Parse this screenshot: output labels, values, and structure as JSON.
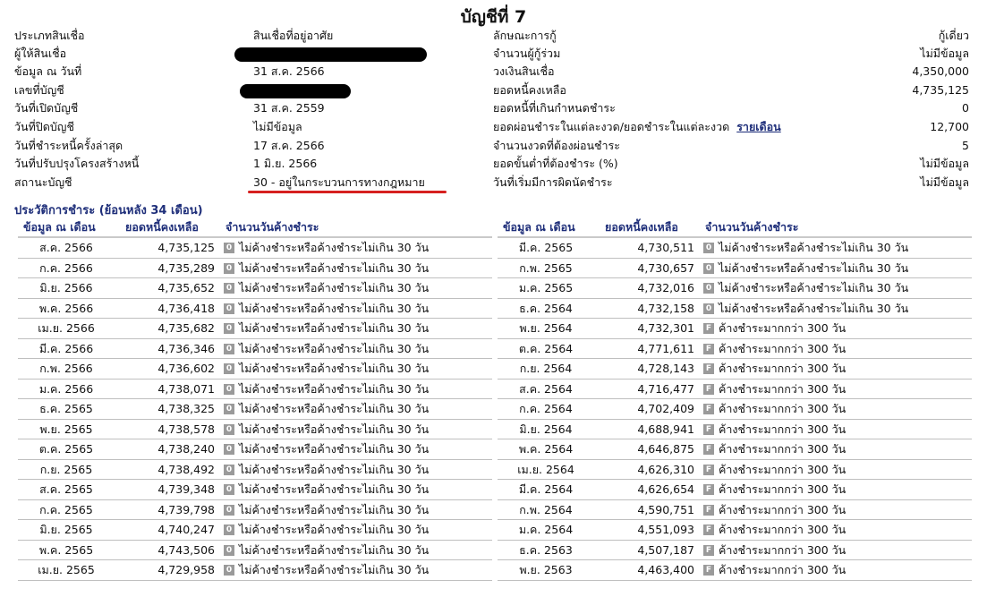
{
  "title": "บัญชีที่ 7",
  "info_left": [
    {
      "label": "ประเภทสินเชื่อ",
      "value": "สินเชื่อที่อยู่อาศัย"
    },
    {
      "label": "ผู้ให้สินเชื่อ",
      "value": ""
    },
    {
      "label": "ข้อมูล ณ วันที่",
      "value": "31 ส.ค. 2566"
    },
    {
      "label": "เลขที่บัญชี",
      "value": ""
    },
    {
      "label": "วันที่เปิดบัญชี",
      "value": "31 ส.ค. 2559"
    },
    {
      "label": "วันที่ปิดบัญชี",
      "value": "ไม่มีข้อมูล"
    },
    {
      "label": "วันที่ชำระหนี้ครั้งล่าสุด",
      "value": "17 ส.ค. 2566"
    },
    {
      "label": "วันที่ปรับปรุงโครงสร้างหนี้",
      "value": "1 มิ.ย. 2566"
    },
    {
      "label": "สถานะบัญชี",
      "value": "30 - อยู่ในกระบวนการทางกฎหมาย"
    }
  ],
  "info_right": [
    {
      "label": "ลักษณะการกู้",
      "value": "กู้เดี่ยว"
    },
    {
      "label": "จำนวนผู้กู้ร่วม",
      "value": "ไม่มีข้อมูล"
    },
    {
      "label": "วงเงินสินเชื่อ",
      "value": "4,350,000"
    },
    {
      "label": "ยอดหนี้คงเหลือ",
      "value": "4,735,125"
    },
    {
      "label": "ยอดหนี้ที่เกินกำหนดชำระ",
      "value": "0"
    },
    {
      "label": "ยอดผ่อนชำระในแต่ละงวด/ยอดชำระในแต่ละงวด",
      "label_link": "รายเดือน",
      "value": "12,700"
    },
    {
      "label": "จำนวนงวดที่ต้องผ่อนชำระ",
      "value": "5"
    },
    {
      "label": "ยอดขั้นต่ำที่ต้องชำระ (%)",
      "value": "ไม่มีข้อมูล"
    },
    {
      "label": "วันที่เริ่มมีการผิดนัดชำระ",
      "value": "ไม่มีข้อมูล"
    }
  ],
  "history_title": "ประวัติการชำระ (ย้อนหลัง 34 เดือน)",
  "history_headers": [
    "ข้อมูล ณ เดือน",
    "ยอดหนี้คงเหลือ",
    "จำนวนวันค้างชำระ"
  ],
  "history_left": [
    {
      "month": "ส.ค. 2566",
      "balance": "4,735,125",
      "code": "0",
      "desc": "ไม่ค้างชำระหรือค้างชำระไม่เกิน 30 วัน"
    },
    {
      "month": "ก.ค. 2566",
      "balance": "4,735,289",
      "code": "0",
      "desc": "ไม่ค้างชำระหรือค้างชำระไม่เกิน 30 วัน"
    },
    {
      "month": "มิ.ย. 2566",
      "balance": "4,735,652",
      "code": "0",
      "desc": "ไม่ค้างชำระหรือค้างชำระไม่เกิน 30 วัน"
    },
    {
      "month": "พ.ค. 2566",
      "balance": "4,736,418",
      "code": "0",
      "desc": "ไม่ค้างชำระหรือค้างชำระไม่เกิน 30 วัน"
    },
    {
      "month": "เม.ย. 2566",
      "balance": "4,735,682",
      "code": "0",
      "desc": "ไม่ค้างชำระหรือค้างชำระไม่เกิน 30 วัน"
    },
    {
      "month": "มี.ค. 2566",
      "balance": "4,736,346",
      "code": "0",
      "desc": "ไม่ค้างชำระหรือค้างชำระไม่เกิน 30 วัน"
    },
    {
      "month": "ก.พ. 2566",
      "balance": "4,736,602",
      "code": "0",
      "desc": "ไม่ค้างชำระหรือค้างชำระไม่เกิน 30 วัน"
    },
    {
      "month": "ม.ค. 2566",
      "balance": "4,738,071",
      "code": "0",
      "desc": "ไม่ค้างชำระหรือค้างชำระไม่เกิน 30 วัน"
    },
    {
      "month": "ธ.ค. 2565",
      "balance": "4,738,325",
      "code": "0",
      "desc": "ไม่ค้างชำระหรือค้างชำระไม่เกิน 30 วัน"
    },
    {
      "month": "พ.ย. 2565",
      "balance": "4,738,578",
      "code": "0",
      "desc": "ไม่ค้างชำระหรือค้างชำระไม่เกิน 30 วัน"
    },
    {
      "month": "ต.ค. 2565",
      "balance": "4,738,240",
      "code": "0",
      "desc": "ไม่ค้างชำระหรือค้างชำระไม่เกิน 30 วัน"
    },
    {
      "month": "ก.ย. 2565",
      "balance": "4,738,492",
      "code": "0",
      "desc": "ไม่ค้างชำระหรือค้างชำระไม่เกิน 30 วัน"
    },
    {
      "month": "ส.ค. 2565",
      "balance": "4,739,348",
      "code": "0",
      "desc": "ไม่ค้างชำระหรือค้างชำระไม่เกิน 30 วัน"
    },
    {
      "month": "ก.ค. 2565",
      "balance": "4,739,798",
      "code": "0",
      "desc": "ไม่ค้างชำระหรือค้างชำระไม่เกิน 30 วัน"
    },
    {
      "month": "มิ.ย. 2565",
      "balance": "4,740,247",
      "code": "0",
      "desc": "ไม่ค้างชำระหรือค้างชำระไม่เกิน 30 วัน"
    },
    {
      "month": "พ.ค. 2565",
      "balance": "4,743,506",
      "code": "0",
      "desc": "ไม่ค้างชำระหรือค้างชำระไม่เกิน 30 วัน"
    },
    {
      "month": "เม.ย. 2565",
      "balance": "4,729,958",
      "code": "0",
      "desc": "ไม่ค้างชำระหรือค้างชำระไม่เกิน 30 วัน"
    }
  ],
  "history_right": [
    {
      "month": "มี.ค. 2565",
      "balance": "4,730,511",
      "code": "0",
      "desc": "ไม่ค้างชำระหรือค้างชำระไม่เกิน 30 วัน"
    },
    {
      "month": "ก.พ. 2565",
      "balance": "4,730,657",
      "code": "0",
      "desc": "ไม่ค้างชำระหรือค้างชำระไม่เกิน 30 วัน"
    },
    {
      "month": "ม.ค. 2565",
      "balance": "4,732,016",
      "code": "0",
      "desc": "ไม่ค้างชำระหรือค้างชำระไม่เกิน 30 วัน"
    },
    {
      "month": "ธ.ค. 2564",
      "balance": "4,732,158",
      "code": "0",
      "desc": "ไม่ค้างชำระหรือค้างชำระไม่เกิน 30 วัน"
    },
    {
      "month": "พ.ย. 2564",
      "balance": "4,732,301",
      "code": "F",
      "desc": "ค้างชำระมากกว่า 300 วัน"
    },
    {
      "month": "ต.ค. 2564",
      "balance": "4,771,611",
      "code": "F",
      "desc": "ค้างชำระมากกว่า 300 วัน"
    },
    {
      "month": "ก.ย. 2564",
      "balance": "4,728,143",
      "code": "F",
      "desc": "ค้างชำระมากกว่า 300 วัน"
    },
    {
      "month": "ส.ค. 2564",
      "balance": "4,716,477",
      "code": "F",
      "desc": "ค้างชำระมากกว่า 300 วัน"
    },
    {
      "month": "ก.ค. 2564",
      "balance": "4,702,409",
      "code": "F",
      "desc": "ค้างชำระมากกว่า 300 วัน"
    },
    {
      "month": "มิ.ย. 2564",
      "balance": "4,688,941",
      "code": "F",
      "desc": "ค้างชำระมากกว่า 300 วัน"
    },
    {
      "month": "พ.ค. 2564",
      "balance": "4,646,875",
      "code": "F",
      "desc": "ค้างชำระมากกว่า 300 วัน"
    },
    {
      "month": "เม.ย. 2564",
      "balance": "4,626,310",
      "code": "F",
      "desc": "ค้างชำระมากกว่า 300 วัน"
    },
    {
      "month": "มี.ค. 2564",
      "balance": "4,626,654",
      "code": "F",
      "desc": "ค้างชำระมากกว่า 300 วัน"
    },
    {
      "month": "ก.พ. 2564",
      "balance": "4,590,751",
      "code": "F",
      "desc": "ค้างชำระมากกว่า 300 วัน"
    },
    {
      "month": "ม.ค. 2564",
      "balance": "4,551,093",
      "code": "F",
      "desc": "ค้างชำระมากกว่า 300 วัน"
    },
    {
      "month": "ธ.ค. 2563",
      "balance": "4,507,187",
      "code": "F",
      "desc": "ค้างชำระมากกว่า 300 วัน"
    },
    {
      "month": "พ.ย. 2563",
      "balance": "4,463,400",
      "code": "F",
      "desc": "ค้างชำระมากกว่า 300 วัน"
    }
  ],
  "colors": {
    "section_title": "#1f2f7a",
    "status_underline": "#d6201f",
    "badge_bg": "#9a9a9a",
    "redaction": "#000000"
  }
}
